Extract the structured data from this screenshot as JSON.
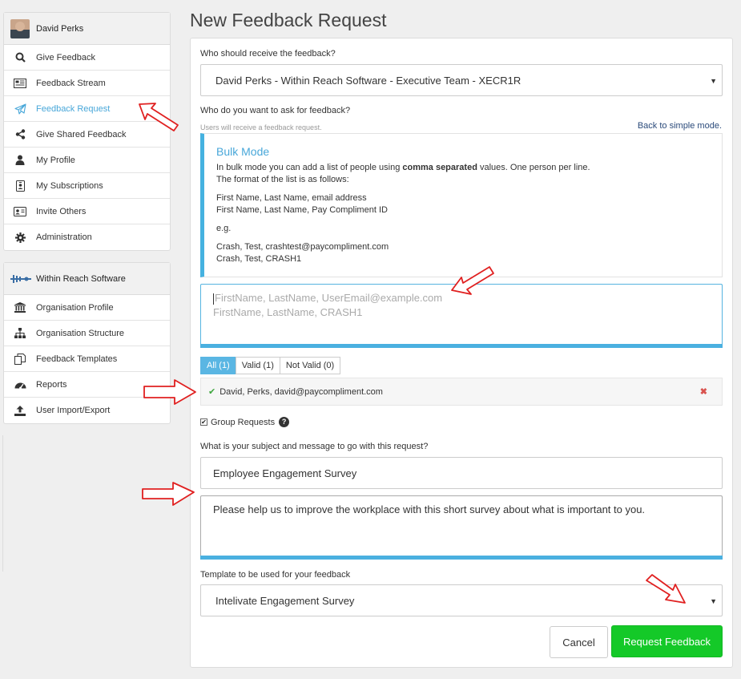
{
  "user": {
    "name": "David Perks"
  },
  "nav": [
    {
      "label": "Give Feedback",
      "icon": "search-icon"
    },
    {
      "label": "Feedback Stream",
      "icon": "newspaper-icon"
    },
    {
      "label": "Feedback Request",
      "icon": "paper-plane-icon",
      "active": true
    },
    {
      "label": "Give Shared Feedback",
      "icon": "share-icon"
    },
    {
      "label": "My Profile",
      "icon": "user-icon"
    },
    {
      "label": "My Subscriptions",
      "icon": "id-badge-icon"
    },
    {
      "label": "Invite Others",
      "icon": "address-card-icon"
    },
    {
      "label": "Administration",
      "icon": "gear-icon"
    }
  ],
  "org": {
    "name": "Within Reach Software",
    "items": [
      {
        "label": "Organisation Profile",
        "icon": "bank-icon"
      },
      {
        "label": "Organisation Structure",
        "icon": "sitemap-icon"
      },
      {
        "label": "Feedback Templates",
        "icon": "copy-icon"
      },
      {
        "label": "Reports",
        "icon": "dashboard-icon"
      },
      {
        "label": "User Import/Export",
        "icon": "upload-icon"
      }
    ]
  },
  "page": {
    "title": "New Feedback Request"
  },
  "form": {
    "receiver_label": "Who should receive the feedback?",
    "receiver_value": "David Perks - Within Reach Software - Executive Team - XECR1R",
    "ask_label": "Who do you want to ask for feedback?",
    "ask_hint": "Users will receive a feedback request.",
    "simple_mode_link": "Back to simple mode.",
    "bulk": {
      "title": "Bulk Mode",
      "intro_pre": "In bulk mode you can add a list of people using ",
      "intro_bold": "comma separated",
      "intro_post": " values. One person per line.",
      "format_line": "The format of the list is as follows:",
      "format_1": "First Name, Last Name, email address",
      "format_2": "First Name, Last Name, Pay Compliment ID",
      "eg": "e.g.",
      "example_1": "Crash, Test, crashtest@paycompliment.com",
      "example_2": "Crash, Test, CRASH1"
    },
    "bulk_placeholder_1": "FirstName, LastName, UserEmail@example.com",
    "bulk_placeholder_2": "FirstName, LastName, CRASH1",
    "filter_tabs": [
      {
        "label": "All (1)",
        "active": true
      },
      {
        "label": "Valid (1)"
      },
      {
        "label": "Not Valid (0)"
      }
    ],
    "result_entry": "David, Perks, david@paycompliment.com",
    "group_requests_label": "Group Requests",
    "group_requests_checked": true,
    "subject_label": "What is your subject and message to go with this request?",
    "subject_value": "Employee Engagement Survey",
    "message_value": "Please help us to improve the workplace with this short survey about what is important to you.",
    "template_label": "Template to be used for your feedback",
    "template_value": "Intelivate Engagement Survey",
    "cancel_label": "Cancel",
    "submit_label": "Request Feedback"
  },
  "colors": {
    "accent": "#48a7d9",
    "submit": "#14c928",
    "arrow": "#e02020"
  }
}
